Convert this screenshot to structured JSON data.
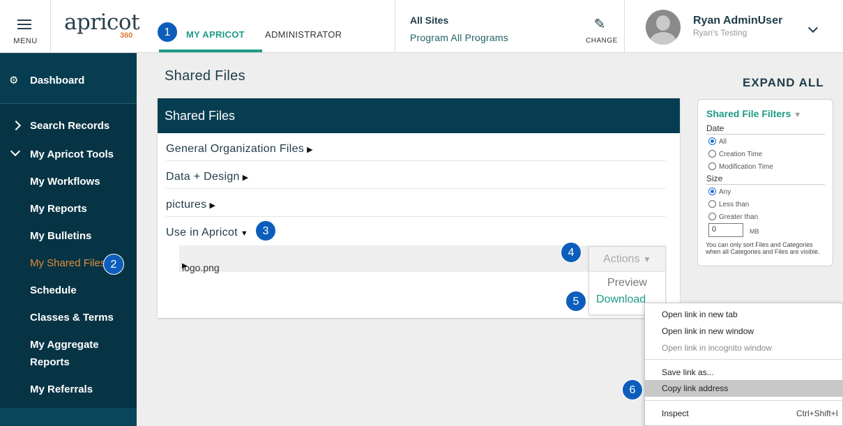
{
  "header": {
    "menu_label": "MENU",
    "logo_text": "apricot",
    "logo_sub": "360",
    "tabs": [
      {
        "label": "MY APRICOT",
        "active": true
      },
      {
        "label": "ADMINISTRATOR",
        "active": false
      }
    ],
    "site_title": "All Sites",
    "program": "Program All Programs",
    "change_label": "CHANGE",
    "user_name": "Ryan AdminUser",
    "user_org": "Ryan's Testing",
    "accent_color": "#1e9a87"
  },
  "sidebar": {
    "dashboard": "Dashboard",
    "search_records": "Search Records",
    "tools_group": "My Apricot Tools",
    "items": [
      {
        "label": "My Workflows"
      },
      {
        "label": "My Reports"
      },
      {
        "label": "My Bulletins"
      },
      {
        "label": "My Shared Files",
        "current": true
      },
      {
        "label": "Schedule"
      },
      {
        "label": "Classes & Terms"
      },
      {
        "label": "My Aggregate"
      },
      {
        "label": "Reports"
      },
      {
        "label": "My Referrals"
      }
    ]
  },
  "main": {
    "page_title": "Shared Files",
    "expand_all": "EXPAND ALL",
    "panel_title": "Shared Files",
    "categories": [
      {
        "label": "General Organization Files",
        "arrow": "▶"
      },
      {
        "label": "Data + Design",
        "arrow": "▶"
      },
      {
        "label": "pictures",
        "arrow": "▶"
      },
      {
        "label": "Use in Apricot",
        "arrow": "▼"
      }
    ],
    "file": {
      "name": "logo.png",
      "arrow": "▶"
    },
    "actions": {
      "button": "Actions",
      "caret": "▼",
      "preview": "Preview",
      "download": "Download"
    }
  },
  "filters": {
    "title": "Shared File Filters",
    "caret": "▼",
    "date_label": "Date",
    "date_options": [
      "All",
      "Creation Time",
      "Modification Time"
    ],
    "date_selected": "All",
    "size_label": "Size",
    "size_options": [
      "Any",
      "Less than",
      "Greater than"
    ],
    "size_selected": "Any",
    "size_value": "0",
    "size_unit": "MB",
    "note": "You can only sort Files and Categories when all Categories and Files are visible."
  },
  "context_menu": {
    "items": [
      {
        "label": "Open link in new tab",
        "disabled": false
      },
      {
        "label": "Open link in new window",
        "disabled": false
      },
      {
        "label": "Open link in incognito window",
        "disabled": true
      },
      {
        "label": "Save link as...",
        "disabled": false
      },
      {
        "label": "Copy link address",
        "disabled": false,
        "highlighted": true
      },
      {
        "label": "Inspect",
        "shortcut": "Ctrl+Shift+I"
      }
    ]
  },
  "badges": [
    "1",
    "2",
    "3",
    "4",
    "5",
    "6"
  ],
  "badge_color": "#0d5ebc"
}
